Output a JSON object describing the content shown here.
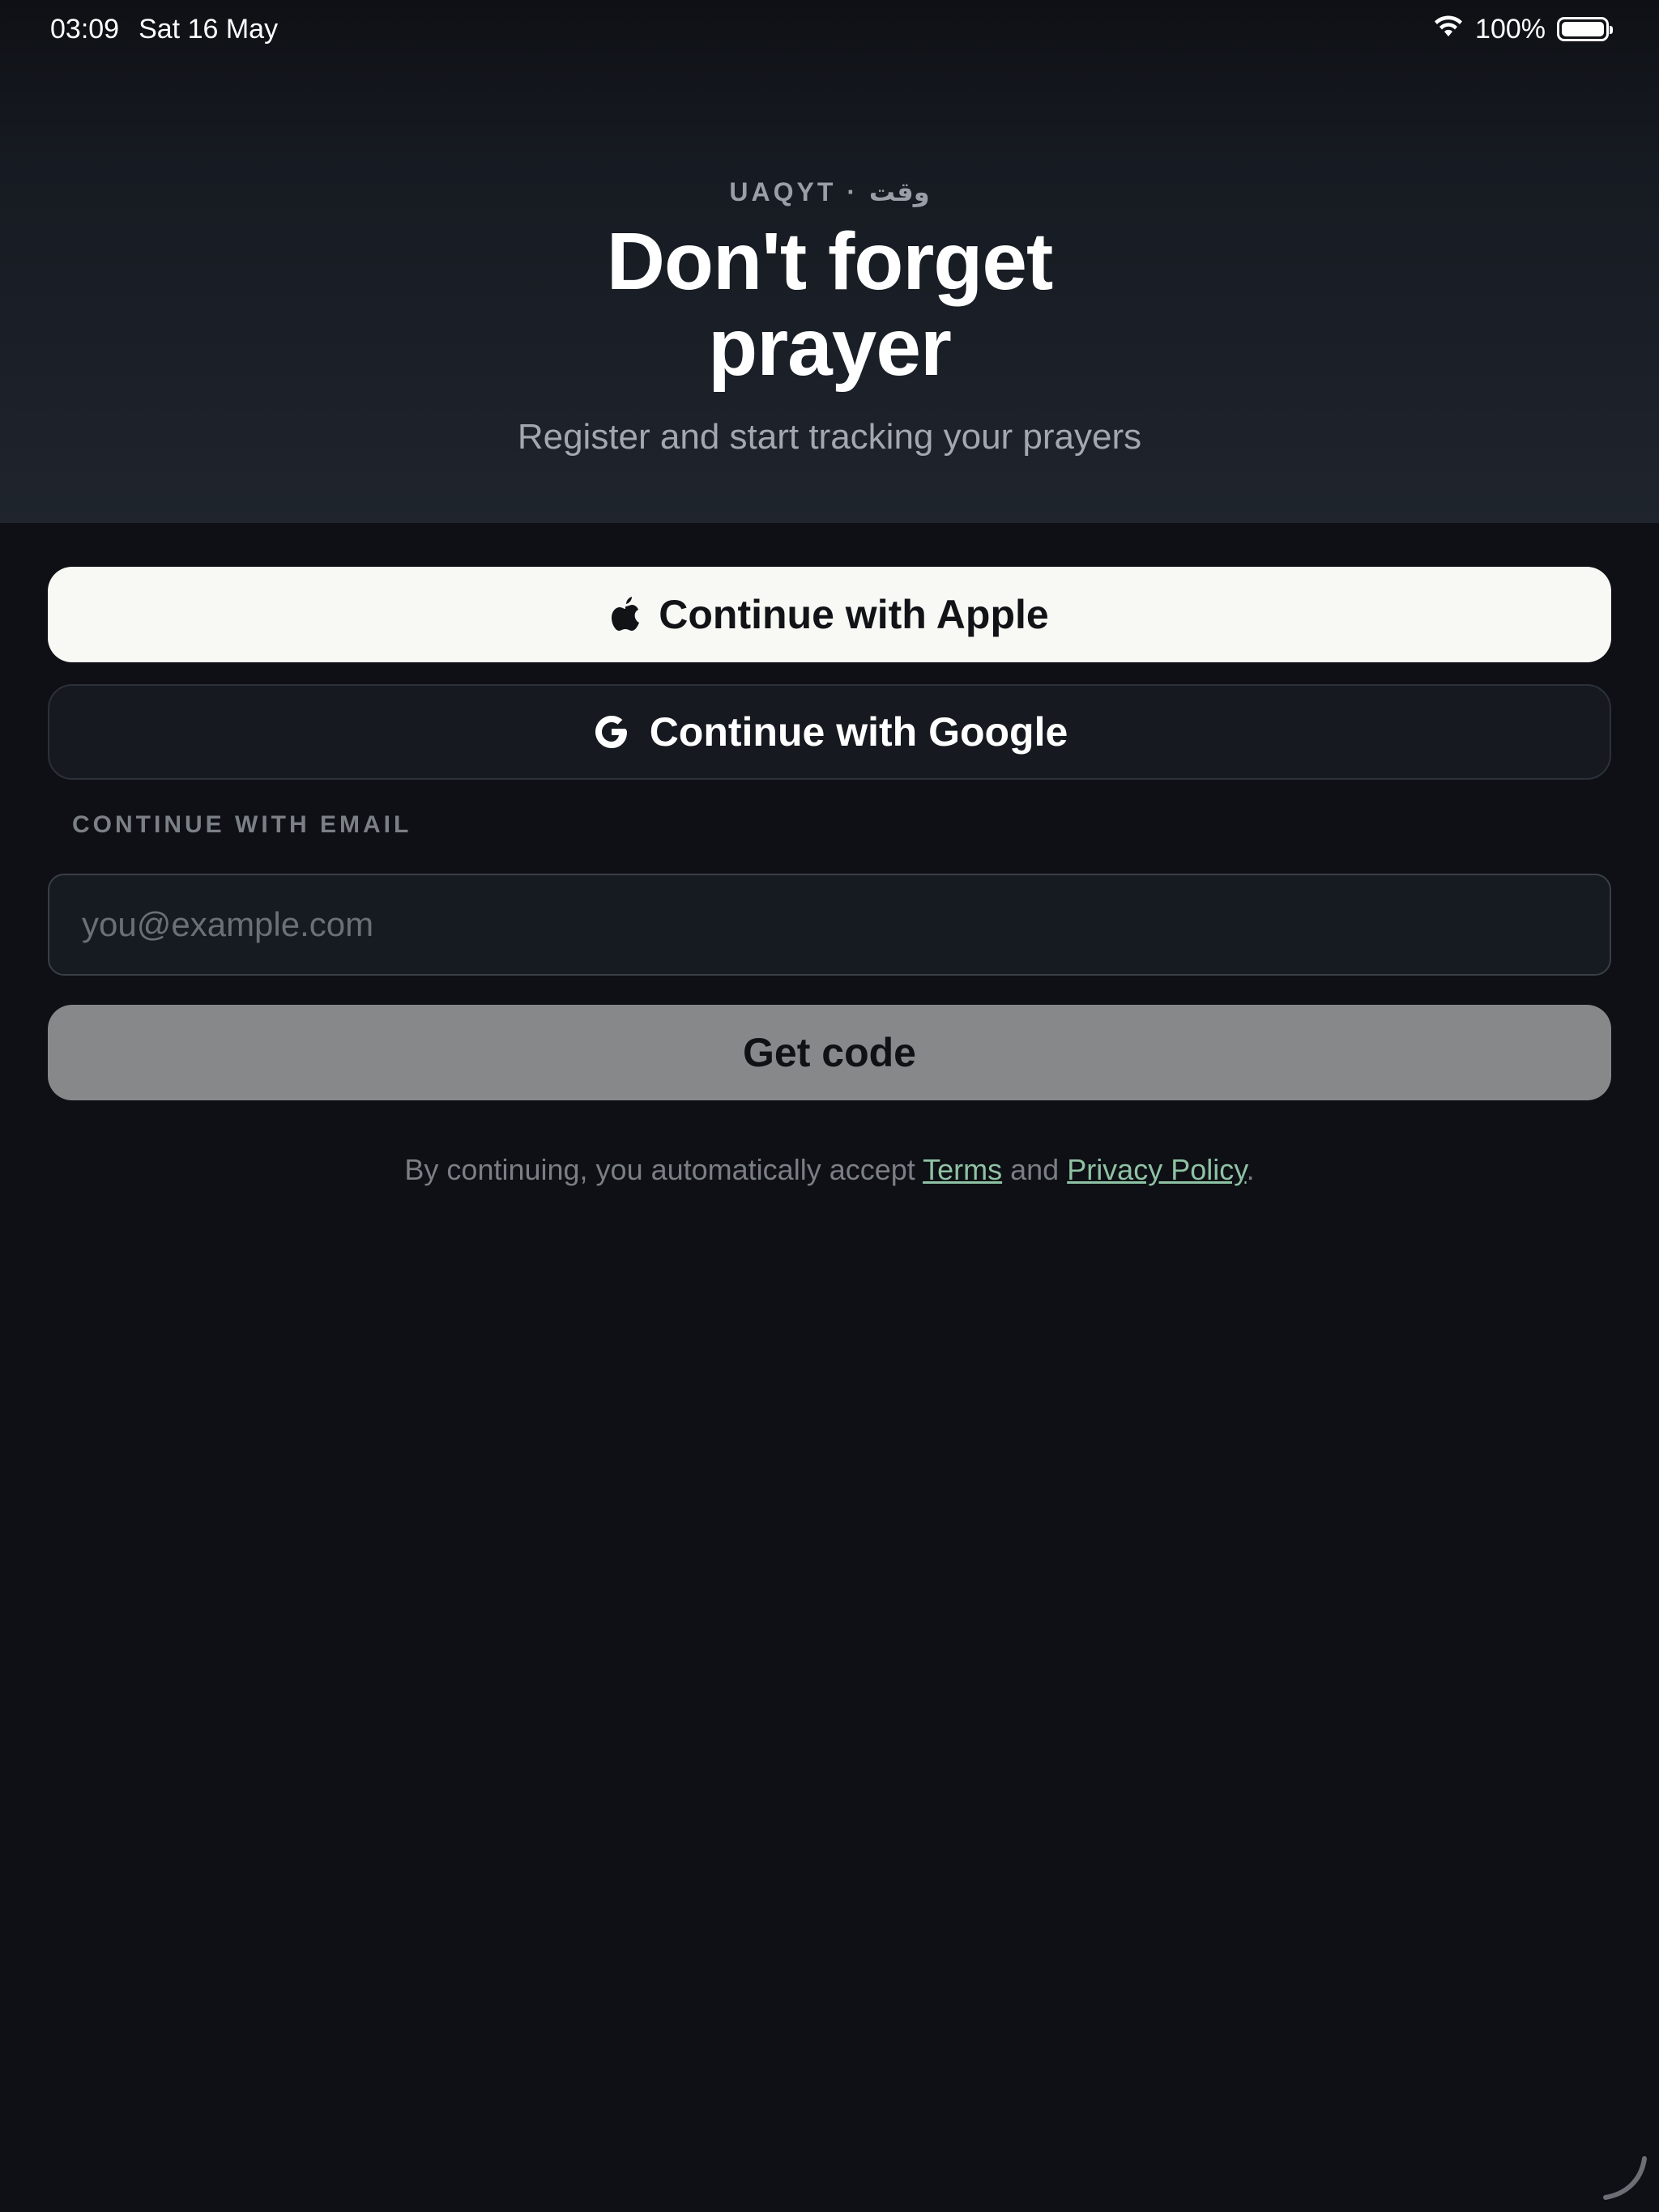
{
  "status_bar": {
    "time": "03:09",
    "date": "Sat 16 May",
    "battery": "100%",
    "icons": [
      "wifi-icon",
      "battery-icon"
    ]
  },
  "hero": {
    "brand": "UAQYT · وقت",
    "title_line1": "Don't forget",
    "title_line2": "prayer",
    "subtitle": "Register and start tracking your prayers"
  },
  "auth": {
    "apple_label": "Continue with Apple",
    "google_label": "Continue with Google",
    "email_section_label": "CONTINUE WITH EMAIL",
    "email_value": "",
    "email_placeholder": "you@example.com",
    "get_code_label": "Get code"
  },
  "legal": {
    "prefix": "By continuing, you automatically accept ",
    "terms": "Terms",
    "and": " and ",
    "privacy": "Privacy Policy",
    "suffix": "."
  },
  "colors": {
    "background": "#0e1015",
    "apple_button": "#f8f8f4",
    "google_button": "#161a20",
    "get_code_button": "#87888a",
    "link": "#8fc2a4"
  }
}
